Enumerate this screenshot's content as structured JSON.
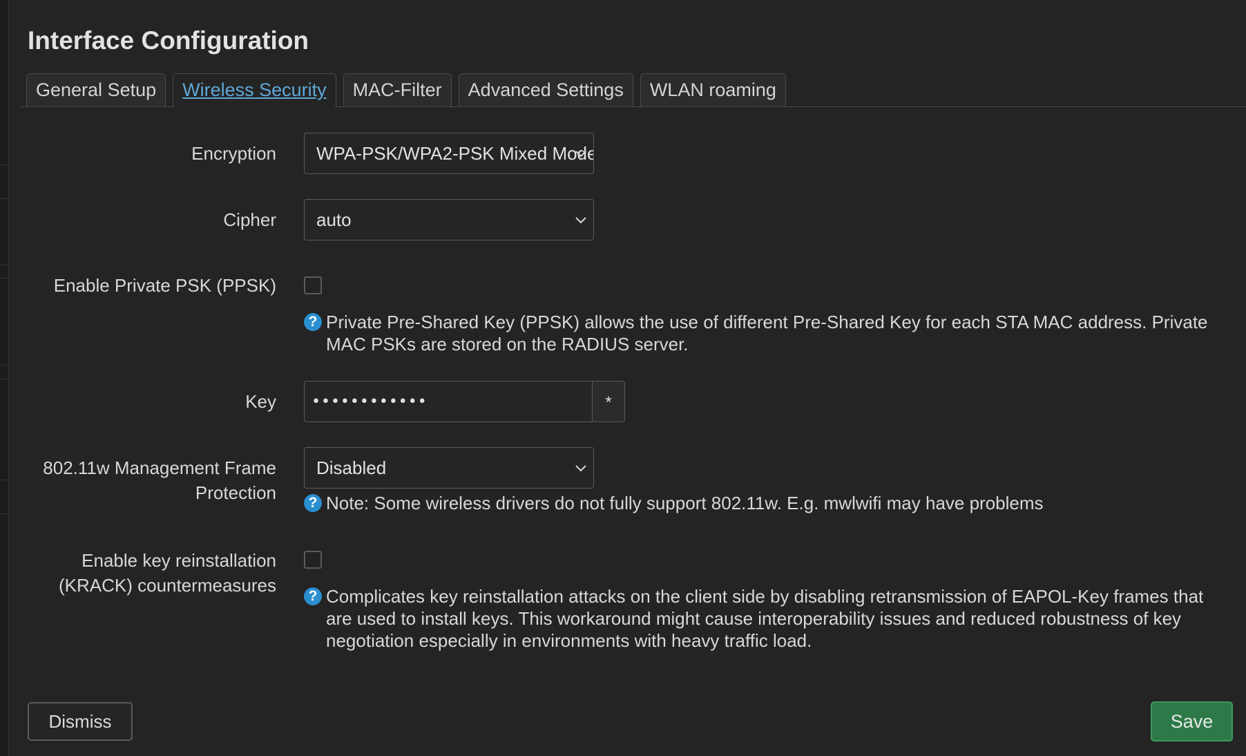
{
  "dialog": {
    "title": "Interface Configuration"
  },
  "tabs": [
    {
      "label": "General Setup",
      "active": false
    },
    {
      "label": "Wireless Security",
      "active": true
    },
    {
      "label": "MAC-Filter",
      "active": false
    },
    {
      "label": "Advanced Settings",
      "active": false
    },
    {
      "label": "WLAN roaming",
      "active": false
    }
  ],
  "form": {
    "encryption": {
      "label": "Encryption",
      "value": "WPA-PSK/WPA2-PSK Mixed Mode"
    },
    "cipher": {
      "label": "Cipher",
      "value": "auto"
    },
    "ppsk": {
      "label": "Enable Private PSK (PPSK)",
      "checked": false,
      "help": "Private Pre-Shared Key (PPSK) allows the use of different Pre-Shared Key for each STA MAC address. Private MAC PSKs are stored on the RADIUS server."
    },
    "key": {
      "label": "Key",
      "value": "••••••••••••",
      "reveal_label": "*"
    },
    "mfp": {
      "label_line1": "802.11w Management Frame",
      "label_line2": "Protection",
      "value": "Disabled",
      "help": "Note: Some wireless drivers do not fully support 802.11w. E.g. mwlwifi may have problems"
    },
    "krack": {
      "label_line1": "Enable key reinstallation",
      "label_line2": "(KRACK) countermeasures",
      "checked": false,
      "help": "Complicates key reinstallation attacks on the client side by disabling retransmission of EAPOL-Key frames that are used to install keys. This workaround might cause interoperability issues and reduced robustness of key negotiation especially in environments with heavy traffic load."
    }
  },
  "footer": {
    "dismiss_label": "Dismiss",
    "save_label": "Save"
  },
  "help_icon_glyph": "?",
  "colors": {
    "background": "#242424",
    "active_tab": "#5fa8d8",
    "help_icon": "#2a8fd0",
    "save_button": "#2d7a48"
  }
}
